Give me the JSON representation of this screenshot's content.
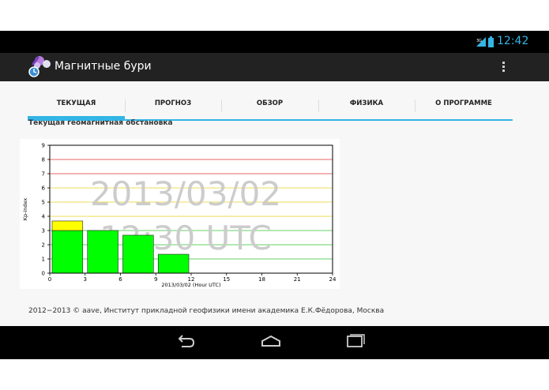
{
  "status_bar": {
    "time": "12:42",
    "network_label": "3G"
  },
  "action_bar": {
    "title": "Магнитные бури"
  },
  "tabs": [
    {
      "label": "ТЕКУЩАЯ",
      "active": true
    },
    {
      "label": "ПРОГНОЗ",
      "active": false
    },
    {
      "label": "ОБЗОР",
      "active": false
    },
    {
      "label": "ФИЗИКА",
      "active": false
    },
    {
      "label": "О ПРОГРАММЕ",
      "active": false
    }
  ],
  "section_title": "Текущая геомагнитная обстановка",
  "footer": "2012−2013 © aave, Институт прикладной геофизики имени академика Е.К.Фёдорова, Москва",
  "colors": {
    "accent": "#33b5e5",
    "bar_green": "#00ff00",
    "bar_yellow": "#ffff00"
  },
  "chart_data": {
    "type": "bar",
    "ylabel": "Kp-index",
    "xlabel": "2013/03/02 (Hour UTC)",
    "ylim": [
      0,
      9
    ],
    "xlim": [
      0,
      24
    ],
    "x_ticks": [
      0,
      3,
      6,
      9,
      12,
      15,
      18,
      21,
      24
    ],
    "y_ticks": [
      0,
      1,
      2,
      3,
      4,
      5,
      6,
      7,
      8,
      9
    ],
    "watermark_date": "2013/03/02",
    "watermark_time": "12:30 UTC",
    "bars": [
      {
        "start": 0,
        "end": 3,
        "value": 3.67
      },
      {
        "start": 3,
        "end": 6,
        "value": 3.0
      },
      {
        "start": 6,
        "end": 9,
        "value": 2.67
      },
      {
        "start": 9,
        "end": 12,
        "value": 1.33
      }
    ],
    "threshold_lines": [
      {
        "level": 9,
        "color": "#e03030"
      },
      {
        "level": 8,
        "color": "#e03030"
      },
      {
        "level": 7,
        "color": "#e03030"
      },
      {
        "level": 6,
        "color": "#e8d020"
      },
      {
        "level": 5,
        "color": "#e8d020"
      },
      {
        "level": 4,
        "color": "#e8d020"
      },
      {
        "level": 3,
        "color": "#30c030"
      },
      {
        "level": 2,
        "color": "#30c030"
      },
      {
        "level": 1,
        "color": "#30c030"
      }
    ],
    "green_max": 3
  }
}
